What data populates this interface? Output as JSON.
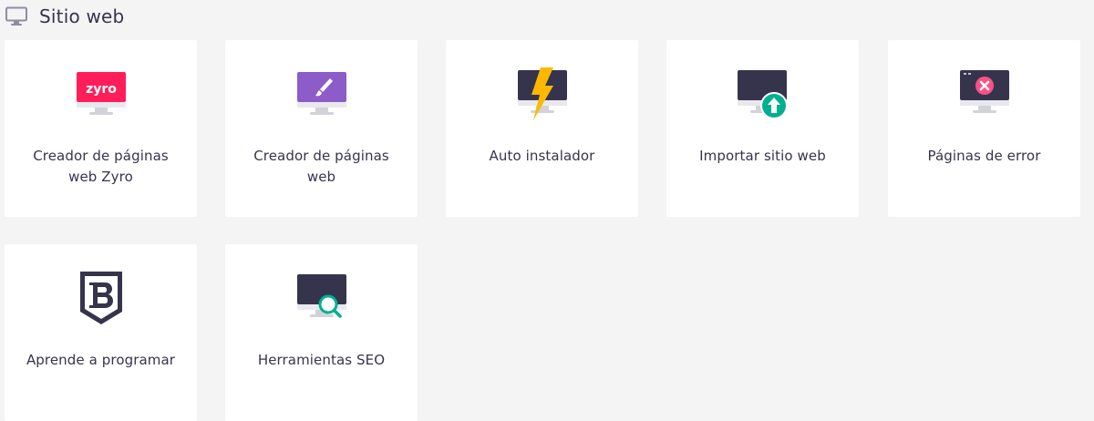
{
  "section": {
    "title": "Sitio web",
    "icon": "monitor-icon"
  },
  "cards": [
    {
      "label": "Creador de páginas web Zyro",
      "icon": "zyro-monitor-icon",
      "logo_text": "zyro",
      "accent": "#ff1e5a"
    },
    {
      "label": "Creador de páginas web",
      "icon": "brush-monitor-icon",
      "accent": "#8c5cc8"
    },
    {
      "label": "Auto instalador",
      "icon": "lightning-monitor-icon",
      "accent": "#ffb800"
    },
    {
      "label": "Importar sitio web",
      "icon": "upload-monitor-icon",
      "accent": "#00b090"
    },
    {
      "label": "Páginas de error",
      "icon": "error-monitor-icon",
      "accent": "#fc5185"
    },
    {
      "label": "Aprende a programar",
      "icon": "b-shield-icon",
      "accent": "#36344d"
    },
    {
      "label": "Herramientas SEO",
      "icon": "seo-search-monitor-icon",
      "accent": "#00b090"
    }
  ],
  "colors": {
    "background": "#f4f4f4",
    "card": "#ffffff",
    "text": "#36344d",
    "screen_dark": "#36344d",
    "stand_gray": "#d5dfff"
  }
}
